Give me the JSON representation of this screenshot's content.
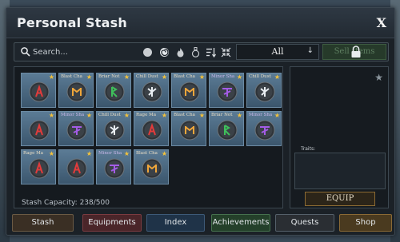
{
  "window": {
    "title": "Personal Stash",
    "close_label": "X"
  },
  "toolbar": {
    "search_placeholder": "Search...",
    "filter_icons": [
      "circle-filter-icon",
      "swirl-filter-icon",
      "flame-filter-icon",
      "potion-filter-icon",
      "sort-icon",
      "collapse-icon"
    ],
    "category": {
      "selected": "All",
      "chevron": "↓"
    },
    "sell_label": "Sell Items"
  },
  "slots": [
    {
      "name": "",
      "rune": "A",
      "color": "#e23b3b",
      "name_color": "#e23b3b",
      "star": "★"
    },
    {
      "name": "Blast Cha",
      "rune": "M",
      "color": "#f0a63a",
      "name_color": "#e8dcc4",
      "star": "★"
    },
    {
      "name": "Briar Not",
      "rune": "R",
      "color": "#3fbf5b",
      "name_color": "#e8dcc4",
      "star": "★"
    },
    {
      "name": "Chill Dust",
      "rune": "K",
      "color": "#e9eef2",
      "name_color": "#e8dcc4",
      "star": "★"
    },
    {
      "name": "Blast Cha",
      "rune": "M",
      "color": "#f0a63a",
      "name_color": "#e8dcc4",
      "star": "★"
    },
    {
      "name": "Minor Sha",
      "rune": "T",
      "color": "#a45ce6",
      "name_color": "#c8b6e8",
      "star": "★"
    },
    {
      "name": "Chill Dust",
      "rune": "K",
      "color": "#e9eef2",
      "name_color": "#e8dcc4",
      "star": "★"
    },
    {
      "name": "",
      "rune": "A",
      "color": "#e23b3b",
      "name_color": "#e23b3b",
      "star": "★"
    },
    {
      "name": "Minor Sha",
      "rune": "T",
      "color": "#a45ce6",
      "name_color": "#c8b6e8",
      "star": "★"
    },
    {
      "name": "Chill Dust",
      "rune": "K",
      "color": "#e9eef2",
      "name_color": "#e8dcc4",
      "star": "★"
    },
    {
      "name": "Rage Ma",
      "rune": "A",
      "color": "#e23b3b",
      "name_color": "#e8dcc4",
      "star": "★"
    },
    {
      "name": "Blast Cha",
      "rune": "M",
      "color": "#f0a63a",
      "name_color": "#e8dcc4",
      "star": "★"
    },
    {
      "name": "Briar Not",
      "rune": "R",
      "color": "#3fbf5b",
      "name_color": "#e8dcc4",
      "star": "★"
    },
    {
      "name": "Minor Sha",
      "rune": "T",
      "color": "#a45ce6",
      "name_color": "#c8b6e8",
      "star": "★"
    },
    {
      "name": "Rage Ma",
      "rune": "A",
      "color": "#e23b3b",
      "name_color": "#e8dcc4",
      "star": "★"
    },
    {
      "name": "",
      "rune": "A",
      "color": "#e23b3b",
      "name_color": "#e23b3b",
      "star": "★"
    },
    {
      "name": "Minor Sha",
      "rune": "T",
      "color": "#a45ce6",
      "name_color": "#c8b6e8",
      "star": "★"
    },
    {
      "name": "Blast Cha",
      "rune": "M",
      "color": "#f0a63a",
      "name_color": "#e8dcc4",
      "star": "★"
    }
  ],
  "stash": {
    "capacity_text": "Stash Capacity: 238/500"
  },
  "detail": {
    "traits_label": "Traits:",
    "equip_label": "EQUIP",
    "favorite_icon": "star-icon"
  },
  "tabs": [
    {
      "label": "Stash",
      "bg": "#3a2f24",
      "border": "#6b5a44"
    },
    {
      "label": "Equipments",
      "bg": "#4a2529",
      "border": "#7a3b40"
    },
    {
      "label": "Index",
      "bg": "#1f3348",
      "border": "#3d5a78"
    },
    {
      "label": "Achievements",
      "bg": "#24402a",
      "border": "#46714e"
    },
    {
      "label": "Quests",
      "bg": "#2a2e33",
      "border": "#55606a"
    },
    {
      "label": "Shop",
      "bg": "#4a3a1f",
      "border": "#8a6a35"
    }
  ]
}
